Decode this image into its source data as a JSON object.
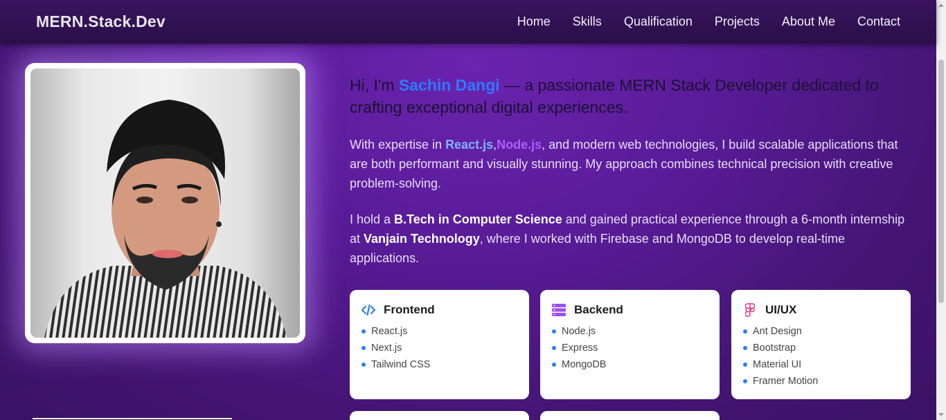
{
  "nav": {
    "brand": "MERN.Stack.Dev",
    "links": [
      "Home",
      "Skills",
      "Qualification",
      "Projects",
      "About Me",
      "Contact"
    ]
  },
  "hero": {
    "intro_prefix": "Hi, I'm ",
    "name": "Sachin Dangi",
    "intro_suffix": " — a passionate MERN Stack Developer dedicated to crafting exceptional digital experiences.",
    "p1_prefix": "With expertise in ",
    "p1_react": "React.js",
    "p1_sep": ",",
    "p1_node": "Node.js",
    "p1_suffix": ", and modern web technologies, I build scalable applications that are both performant and visually stunning. My approach combines technical precision with creative problem-solving.",
    "p2_prefix": "I hold a ",
    "p2_degree": "B.Tech in Computer Science",
    "p2_mid": " and gained practical experience through a 6-month internship at ",
    "p2_company": "Vanjain Technology",
    "p2_suffix": ", where I worked with Firebase and MongoDB to develop real-time applications."
  },
  "skills": [
    {
      "title": "Frontend",
      "icon": "code-icon",
      "items": [
        "React.js",
        "Next.js",
        "Tailwind CSS"
      ]
    },
    {
      "title": "Backend",
      "icon": "server-icon",
      "items": [
        "Node.js",
        "Express",
        "MongoDB"
      ]
    },
    {
      "title": "UI/UX",
      "icon": "figma-icon",
      "items": [
        "Ant Design",
        "Bootstrap",
        "Material UI",
        "Framer Motion"
      ]
    }
  ],
  "colors": {
    "accent_blue": "#2b7bff",
    "accent_purple": "#b05cff",
    "background": "#5a1c99",
    "navbar": "#2b0f49"
  }
}
